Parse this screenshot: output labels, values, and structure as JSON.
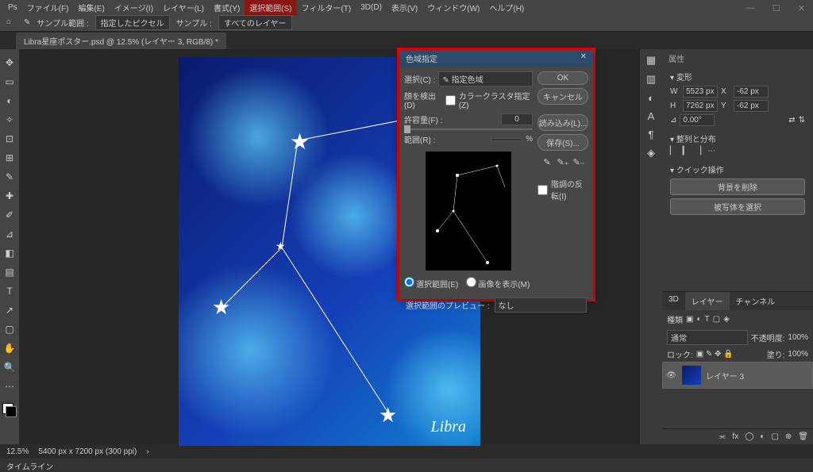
{
  "app": {
    "title": "Ps"
  },
  "menu": {
    "items": [
      "ファイル(F)",
      "編集(E)",
      "イメージ(I)",
      "レイヤー(L)",
      "書式(Y)",
      "選択範囲(S)",
      "フィルター(T)",
      "3D(D)",
      "表示(V)",
      "ウィンドウ(W)",
      "ヘルプ(H)"
    ],
    "selected_index": 5
  },
  "options": {
    "sample_area_lbl": "サンプル範囲 :",
    "sample_area_val": "指定したピクセル",
    "sample_lbl": "サンプル :",
    "sample_val": "すべてのレイヤー"
  },
  "tab": {
    "name": "Libra星座ポスター.psd @ 12.5% (レイヤー 3, RGB/8) *"
  },
  "poster": {
    "label": "Libra"
  },
  "status": {
    "zoom": "12.5%",
    "dims": "5400 px x 7200 px (300 ppi)"
  },
  "timeline": {
    "label": "タイムライン"
  },
  "props": {
    "title": "属性",
    "section": "変形",
    "w_lbl": "W",
    "w_val": "5523 px",
    "x_lbl": "X",
    "x_val": "-62 px",
    "h_lbl": "H",
    "h_val": "7262 px",
    "y_lbl": "Y",
    "y_val": "-62 px",
    "angle_val": "0.00°",
    "align_title": "整列と分布",
    "quick_title": "クイック操作",
    "quick_btn1": "背景を削除",
    "quick_btn2": "被写体を選択"
  },
  "layers": {
    "tabs": [
      "3D",
      "レイヤー",
      "チャンネル"
    ],
    "active_tab": 1,
    "kind_lbl": "種類",
    "blend": "通常",
    "opacity_lbl": "不透明度:",
    "opacity_val": "100%",
    "lock_lbl": "ロック:",
    "fill_lbl": "塗り:",
    "fill_val": "100%",
    "layer_name": "レイヤー 3"
  },
  "dialog": {
    "title": "色域指定",
    "select_lbl": "選択(C) :",
    "select_val": "✎ 指定色域",
    "face_detect": "顔を検出(D)",
    "cluster_chk": "カラークラスタ指定 (Z)",
    "fuzz_lbl": "許容量(F) :",
    "fuzz_val": "0",
    "range_lbl": "範囲(R) :",
    "range_val": "",
    "range_pct": "%",
    "radio1": "選択範囲(E)",
    "radio2": "画像を表示(M)",
    "preview_lbl": "選択範囲のプレビュー :",
    "preview_val": "なし",
    "ok": "OK",
    "cancel": "キャンセル",
    "load": "読み込み(L)...",
    "save": "保存(S)...",
    "invert": "階調の反転(I)"
  }
}
